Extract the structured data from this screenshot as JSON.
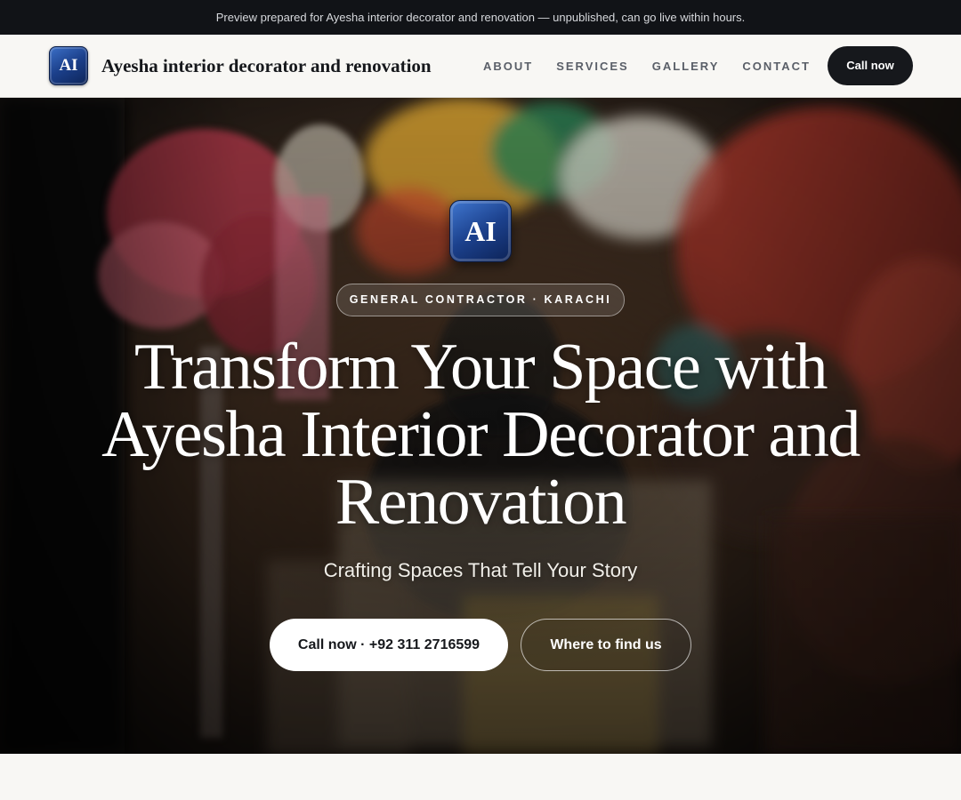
{
  "banner": {
    "text": "Preview prepared for Ayesha interior decorator and renovation — unpublished, can go live within hours."
  },
  "header": {
    "logo_text": "AI",
    "brand_name": "Ayesha interior decorator and renovation",
    "nav": [
      "ABOUT",
      "SERVICES",
      "GALLERY",
      "CONTACT"
    ],
    "cta_label": "Call now"
  },
  "hero": {
    "logo_text": "AI",
    "badge": "GENERAL CONTRACTOR · KARACHI",
    "title": "Transform Your Space with Ayesha Interior Decorator and Renovation",
    "subtitle": "Crafting Spaces That Tell Your Story",
    "primary_button": "Call now · +92 311 2716599",
    "secondary_button": "Where to find us"
  },
  "colors": {
    "banner_bg": "#111317",
    "nav_bg": "#f8f7f4",
    "brand_text": "#16181c",
    "logo_blue": "#1b3f8a",
    "cta_bg": "#16181c"
  }
}
